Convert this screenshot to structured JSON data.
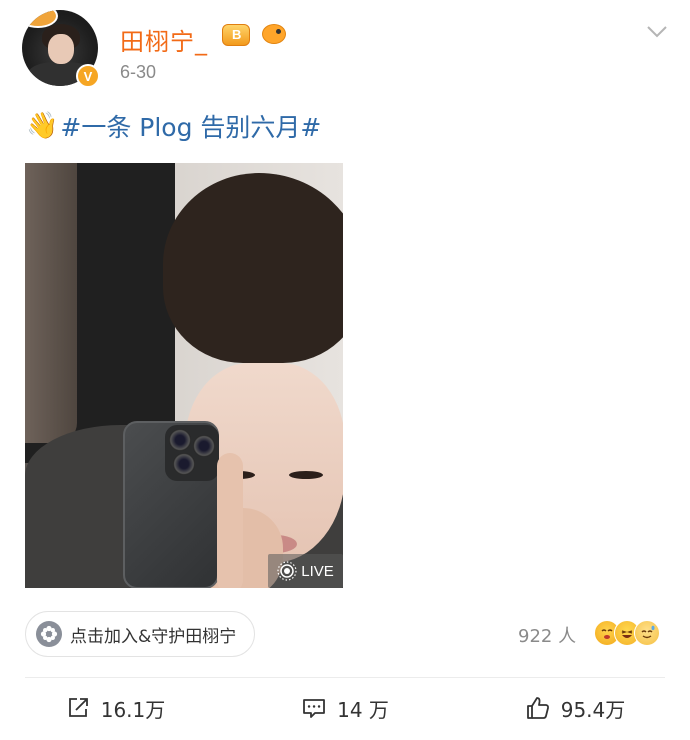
{
  "post": {
    "author": {
      "name": "田栩宁_",
      "verified_badge": "V",
      "badges": [
        "fan-crown-badge",
        "fish-badge"
      ]
    },
    "date": "6-30",
    "text": {
      "emoji": "👋",
      "topic": "#一条 Plog 告别六月#"
    },
    "media": {
      "live_label": "LIVE"
    },
    "supporter": {
      "button_label": "点击加入&守护田栩宁",
      "count": "922 人"
    },
    "actions": {
      "repost": "16.1万",
      "comments": "14 万",
      "likes": "95.4万"
    }
  },
  "colors": {
    "username": "#f26a16",
    "topic": "#2f6aa8",
    "muted": "#8a8a8a"
  }
}
